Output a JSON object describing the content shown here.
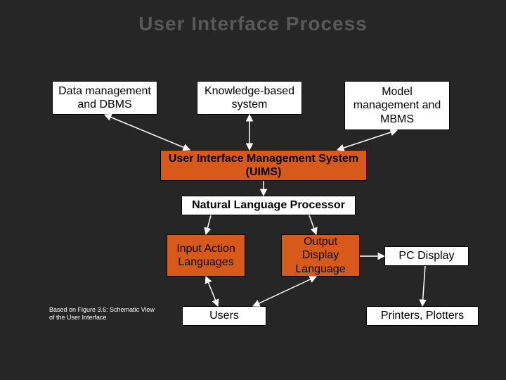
{
  "title": "User Interface Process",
  "boxes": {
    "data_mgmt": "Data management and DBMS",
    "kbs": "Knowledge-based system",
    "model_mgmt": "Model management and MBMS",
    "uims": "User Interface Management System (UIMS)",
    "nlp": "Natural Language Processor",
    "input_lang": "Input Action Languages",
    "output_lang": "Output Display Language",
    "pc_display": "PC Display",
    "users": "Users",
    "printers": "Printers, Plotters"
  },
  "caption": "Based on Figure 3.6: Schematic View of the User Interface"
}
